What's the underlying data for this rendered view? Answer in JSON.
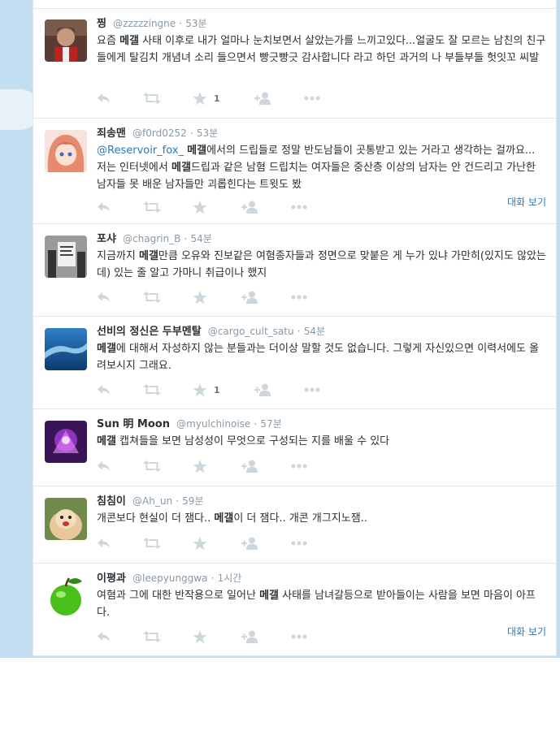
{
  "tweets": [
    {
      "name": "찡",
      "handle": "@zzzzzingne",
      "time": "53분",
      "text_parts": [
        "요즘 ",
        "메갤",
        " 사태 이후로 내가 얼마나 눈치보면서 살았는가를 느끼고있다...얼굴도 잘 모르는 남친의 친구들에게 탈김치 개념녀 소리 들으면서 빵긋빵긋 감사합니다 라고 하던 과거의 나 부들부들 헛잇꼬 씨발"
      ],
      "favorite_count": "1",
      "conversation": ""
    },
    {
      "name": "죄송맨",
      "handle": "@f0rd0252",
      "time": "53분",
      "text_parts": [
        "@Reservoir_fox_",
        " ",
        "메갤",
        "에서의 드립들로 정말 반도남들이 곳통받고 있는 거라고 생각하는 걸까요... 저는 인터넷에서 ",
        "메갤",
        "드립과 같은 남혐 드립치는 여자들은 중산층 이상의 남자는 안 건드리고 가난한 남자들 못 배운 남자들만 괴롭힌다는 트윗도 봤"
      ],
      "favorite_count": "",
      "conversation": "대화 보기"
    },
    {
      "name": "포샤",
      "handle": "@chagrin_B",
      "time": "54분",
      "text_parts": [
        "지금까지 ",
        "메갤",
        "만큼 오유와 진보같은 여혐종자들과 정면으로 맞붙은 게 누가 있냐 가만히(있지도 않았는데) 있는 줄 알고 가마니 취급이나 했지"
      ],
      "favorite_count": "",
      "conversation": ""
    },
    {
      "name": "선비의 정신은 두부멘탈",
      "handle": "@cargo_cult_satu",
      "time": "54분",
      "text_parts": [
        "메갤",
        "에 대해서 자성하지 않는 분들과는 더이상 말할 것도 없습니다. 그렇게 자신있으면 이력서에도 올려보시지 그래요."
      ],
      "favorite_count": "1",
      "conversation": ""
    },
    {
      "name": "Sun 明 Moon",
      "handle": "@myulchinoise",
      "time": "57분",
      "text_parts": [
        "메갤",
        " 캡쳐들을 보면 남성성이 무엇으로 구성되는 지를 배울 수 있다"
      ],
      "favorite_count": "",
      "conversation": ""
    },
    {
      "name": "침침이",
      "handle": "@Ah_un",
      "time": "59분",
      "text_parts": [
        "개콘보다 현실이 더 잼다.. ",
        "메갤",
        "이 더 잼다..  개콘 개그지노잼.."
      ],
      "favorite_count": "",
      "conversation": ""
    },
    {
      "name": "이평과",
      "handle": "@leepyunggwa",
      "time": "1시간",
      "text_parts": [
        "여혐과 그에 대한 반작용으로 일어난 ",
        "메갤",
        " 사태를 남녀갈등으로 받아들이는 사람을 보면 마음이 아프다."
      ],
      "favorite_count": "",
      "conversation": "대화 보기"
    }
  ],
  "icons": {
    "reply": "reply-icon",
    "retweet": "retweet-icon",
    "favorite": "star-icon",
    "follow": "follow-icon",
    "more": "more-icon"
  },
  "colors": {
    "background_sky": "#c2def0",
    "link": "#2b7bb9",
    "action_icon": "#ccd6dd",
    "text": "#292f33",
    "meta": "#8899a6"
  }
}
